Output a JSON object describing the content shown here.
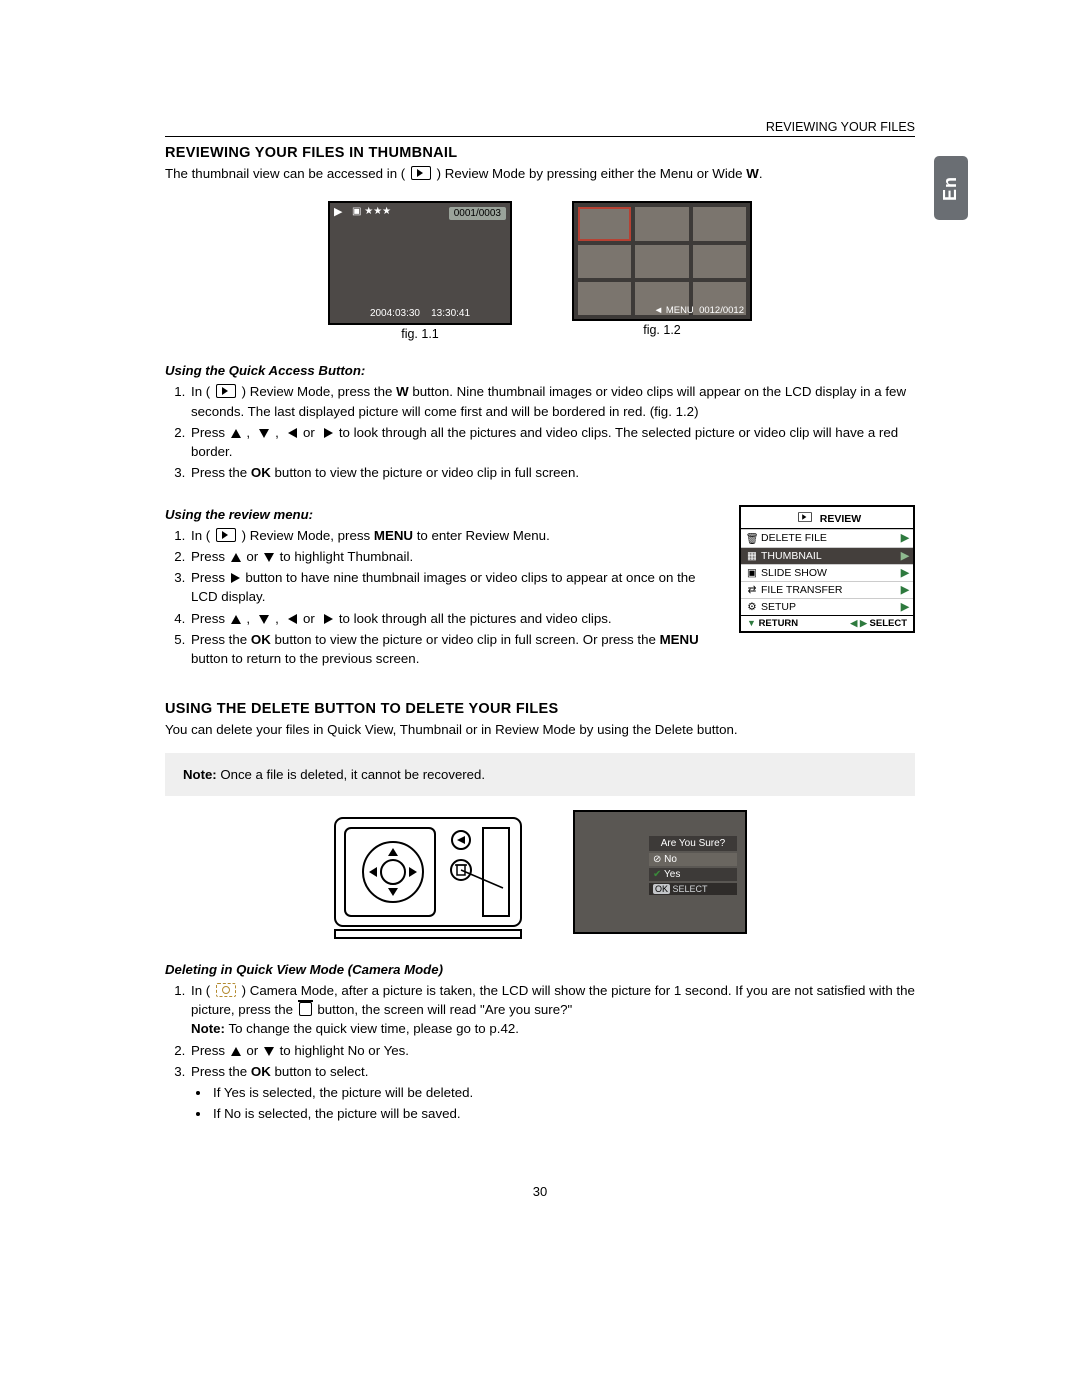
{
  "header": {
    "breadcrumb": "REVIEWING YOUR FILES",
    "lang_tab": "En"
  },
  "section1": {
    "title": "REVIEWING YOUR FILES IN THUMBNAIL",
    "intro_a": "The thumbnail view can be accessed in ( ",
    "intro_b": " ) Review Mode by pressing either the Menu or Wide ",
    "intro_w": "W",
    "intro_c": ".",
    "fig1": {
      "counter": "0001/0003",
      "date": "2004:03:30",
      "time": "13:30:41",
      "caption": "fig. 1.1"
    },
    "fig2": {
      "menu_label": "MENU",
      "counter": "0012/0012",
      "caption": "fig. 1.2"
    },
    "quick": {
      "heading": "Using the Quick Access Button:",
      "s1a": "In ( ",
      "s1b": " ) Review Mode, press the ",
      "s1w": "W",
      "s1c": " button. Nine thumbnail images or video clips will appear on the LCD display in a few seconds. The last displayed picture will come first and will be bordered in red. (fig. 1.2)",
      "s2a": "Press ",
      "s2b": " to look through all the pictures and video clips. The selected picture or video clip will have a red border.",
      "s3a": "Press the ",
      "s3ok": "OK",
      "s3b": " button to view the picture or video clip in full screen."
    },
    "review": {
      "heading": "Using the review menu:",
      "s1a": "In ( ",
      "s1b": " ) Review Mode, press ",
      "s1m": "MENU",
      "s1c": " to enter Review Menu.",
      "s2a": "Press ",
      "s2b": " or ",
      "s2c": " to highlight Thumbnail.",
      "s3a": "Press ",
      "s3b": " button to have nine thumbnail images or video clips to appear at once on the LCD display.",
      "s4a": "Press ",
      "s4b": " to look through all the pictures and video clips.",
      "s5a": "Press the ",
      "s5ok": "OK",
      "s5b": " button to view the picture or video clip in full screen. Or press the ",
      "s5m": "MENU",
      "s5c": " button to return to the previous screen."
    },
    "menu_box": {
      "header": "REVIEW",
      "rows": {
        "delete": "DELETE FILE",
        "thumb": "THUMBNAIL",
        "slide": "SLIDE SHOW",
        "transfer": "FILE TRANSFER",
        "setup": "SETUP"
      },
      "footer": {
        "return": "RETURN",
        "select": "SELECT"
      }
    }
  },
  "section2": {
    "title": "USING THE DELETE BUTTON TO DELETE YOUR FILES",
    "intro": "You can delete your files in Quick View, Thumbnail or in Review Mode by using the Delete button.",
    "note_label": "Note:",
    "note_body": " Once a file is deleted, it cannot be recovered.",
    "popup": {
      "q": "Are You Sure?",
      "no": "No",
      "yes": "Yes",
      "select": "SELECT",
      "ok": "OK"
    },
    "del": {
      "heading": "Deleting in Quick View Mode (Camera Mode)",
      "s1a": "In ( ",
      "s1b": " ) Camera Mode, after a picture is taken, the LCD will show the picture for 1 second. If you are not satisfied with the picture, press the ",
      "s1c": " button, the screen will read \"Are you sure?\"",
      "s1note_l": "Note:",
      "s1note_b": " To change the quick view time, please go to p.42.",
      "s2a": "Press ",
      "s2b": " or ",
      "s2c": " to highlight No or Yes.",
      "s3a": "Press the ",
      "s3ok": "OK",
      "s3b": " button to select.",
      "b1": "If Yes is selected, the picture will be deleted.",
      "b2": "If No is selected, the picture will be saved."
    }
  },
  "page_number": "30"
}
